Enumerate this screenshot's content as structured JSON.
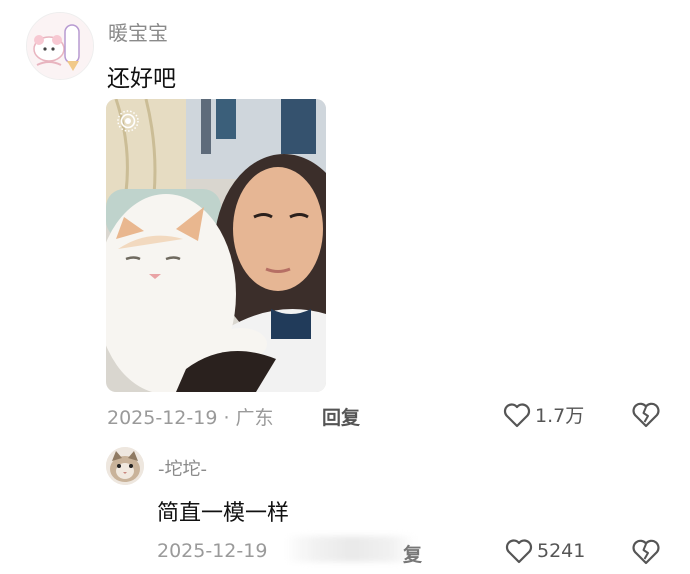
{
  "comment": {
    "username": "暖宝宝",
    "text": "还好吧",
    "date_location": "2025-12-19 · 广东",
    "reply_label": "回复",
    "likes": "1.7万"
  },
  "reply": {
    "username": "-坨坨-",
    "text": "简直一模一样",
    "date": "2025-12-19",
    "reply_tail": "复",
    "likes": "5241"
  },
  "icons": {
    "like": "heart-outline-icon",
    "dislike": "broken-heart-icon",
    "live_photo": "live-photo-icon"
  },
  "colors": {
    "meta_gray": "#9a9a9a",
    "text": "#111111"
  }
}
